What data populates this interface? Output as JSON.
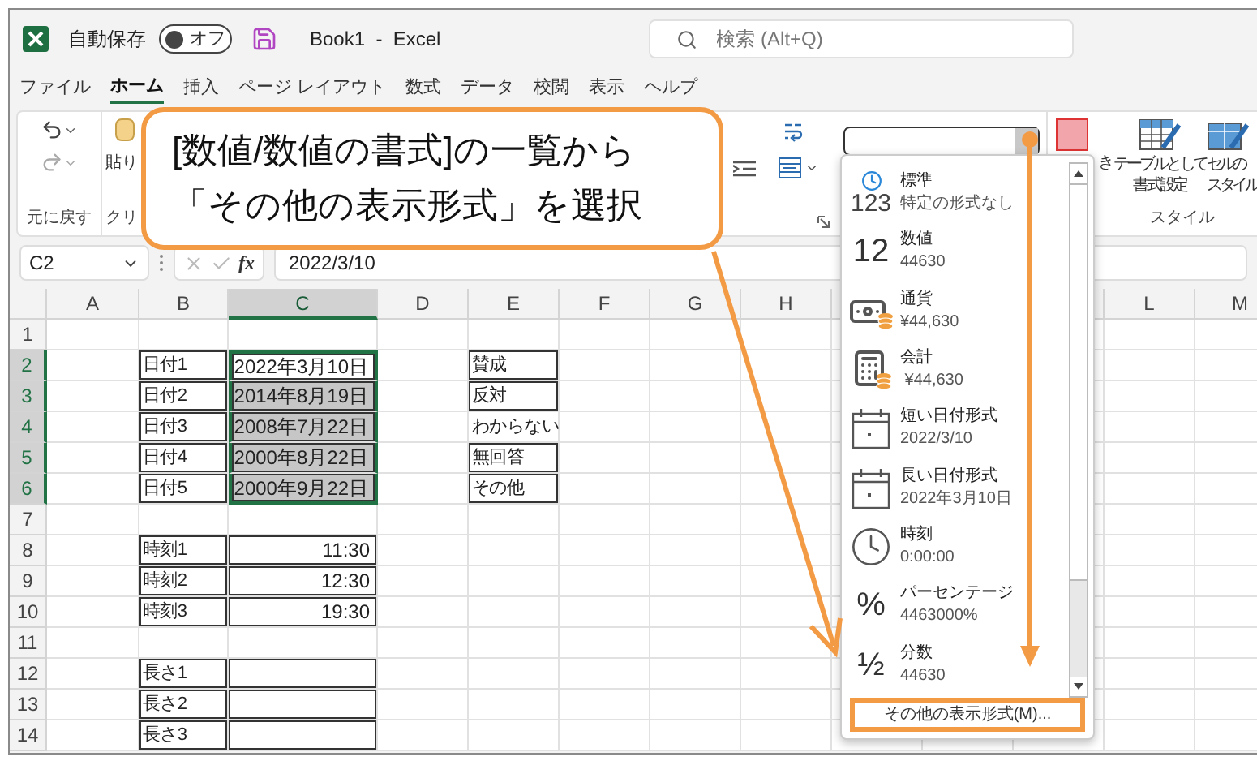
{
  "title_bar": {
    "autosave_label": "自動保存",
    "autosave_toggle": {
      "on": false,
      "label": "オフ"
    },
    "document_title": "Book1  -  Excel",
    "search": {
      "placeholder": "検索 (Alt+Q)"
    }
  },
  "menu_tabs": [
    {
      "label": "ファイル",
      "selected": false
    },
    {
      "label": "ホーム",
      "selected": true
    },
    {
      "label": "挿入",
      "selected": false
    },
    {
      "label": "ページ レイアウト",
      "selected": false
    },
    {
      "label": "数式",
      "selected": false
    },
    {
      "label": "データ",
      "selected": false
    },
    {
      "label": "校閲",
      "selected": false
    },
    {
      "label": "表示",
      "selected": false
    },
    {
      "label": "ヘルプ",
      "selected": false
    }
  ],
  "ribbon": {
    "undo_group_label": "元に戻す",
    "paste_label": "貼り",
    "clipboard_group_label": "クリ",
    "number_format_box": {
      "expanded": true
    },
    "cut_button_label": "き",
    "style_buttons": [
      {
        "kind": "table",
        "lines": [
          "テーブルとして",
          "書式設定"
        ]
      },
      {
        "kind": "cell",
        "lines": [
          "セルの",
          "スタイル"
        ]
      }
    ],
    "style_group_label": "スタイル"
  },
  "formula_bar": {
    "name_box": "C2",
    "function_label": "fx",
    "formula": "2022/3/10"
  },
  "sheet": {
    "columns_left": [
      {
        "label": "A",
        "selected": false
      },
      {
        "label": "B",
        "selected": false
      },
      {
        "label": "C",
        "selected": true
      },
      {
        "label": "D",
        "selected": false
      },
      {
        "label": "E",
        "selected": false
      },
      {
        "label": "F",
        "selected": false
      },
      {
        "label": "G",
        "selected": false
      },
      {
        "label": "H",
        "selected": false
      }
    ],
    "columns_right": [
      {
        "label": "L",
        "selected": false
      },
      {
        "label": "M",
        "selected": false
      }
    ],
    "rows": [
      {
        "number": "1",
        "selected": false
      },
      {
        "number": "2",
        "selected": true,
        "b": {
          "text": "日付1",
          "bordered": true
        },
        "c": {
          "text": "2022年3月10日",
          "bordered": true,
          "selected": true,
          "active": true
        },
        "e": {
          "text": "賛成",
          "bordered": true
        }
      },
      {
        "number": "3",
        "selected": true,
        "b": {
          "text": "日付2",
          "bordered": true
        },
        "c": {
          "text": "2014年8月19日",
          "bordered": true,
          "selected": true,
          "active": false
        },
        "e": {
          "text": "反対",
          "bordered": true
        }
      },
      {
        "number": "4",
        "selected": true,
        "b": {
          "text": "日付3",
          "bordered": true
        },
        "c": {
          "text": "2008年7月22日",
          "bordered": true,
          "selected": true,
          "active": false
        },
        "e": {
          "text": "わからない",
          "bordered": false
        }
      },
      {
        "number": "5",
        "selected": true,
        "b": {
          "text": "日付4",
          "bordered": true
        },
        "c": {
          "text": "2000年8月22日",
          "bordered": true,
          "selected": true,
          "active": false
        },
        "e": {
          "text": "無回答",
          "bordered": true
        }
      },
      {
        "number": "6",
        "selected": true,
        "b": {
          "text": "日付5",
          "bordered": true
        },
        "c": {
          "text": "2000年9月22日",
          "bordered": true,
          "selected": true,
          "active": false
        },
        "e": {
          "text": "その他",
          "bordered": true
        }
      },
      {
        "number": "7",
        "selected": false
      },
      {
        "number": "8",
        "selected": false,
        "b": {
          "text": "時刻1",
          "bordered": true
        },
        "c": {
          "text": "11:30",
          "bordered": true,
          "selected": false,
          "active": false
        }
      },
      {
        "number": "9",
        "selected": false,
        "b": {
          "text": "時刻2",
          "bordered": true
        },
        "c": {
          "text": "12:30",
          "bordered": true,
          "selected": false,
          "active": false
        }
      },
      {
        "number": "10",
        "selected": false,
        "b": {
          "text": "時刻3",
          "bordered": true
        },
        "c": {
          "text": "19:30",
          "bordered": true,
          "selected": false,
          "active": false
        }
      },
      {
        "number": "11",
        "selected": false
      },
      {
        "number": "12",
        "selected": false,
        "b": {
          "text": "長さ1",
          "bordered": true
        },
        "c": {
          "bordered": true,
          "selected": false,
          "active": false
        }
      },
      {
        "number": "13",
        "selected": false,
        "b": {
          "text": "長さ2",
          "bordered": true
        },
        "c": {
          "bordered": true,
          "selected": false,
          "active": false
        }
      },
      {
        "number": "14",
        "selected": false,
        "b": {
          "text": "長さ3",
          "bordered": true
        },
        "c": {
          "bordered": true,
          "selected": false,
          "active": false
        }
      }
    ]
  },
  "format_menu": {
    "items": [
      {
        "kind": "general",
        "glyph": "123",
        "label": "標準",
        "sample": "特定の形式なし"
      },
      {
        "kind": "number",
        "glyph": "12",
        "label": "数値",
        "sample": "44630"
      },
      {
        "kind": "currency",
        "label": "通貨",
        "sample": "¥44,630"
      },
      {
        "kind": "accounting",
        "label": "会計",
        "sample": " ¥44,630"
      },
      {
        "kind": "short_date",
        "label": "短い日付形式",
        "sample": "2022/3/10"
      },
      {
        "kind": "long_date",
        "label": "長い日付形式",
        "sample": "2022年3月10日"
      },
      {
        "kind": "time",
        "label": "時刻",
        "sample": "0:00:00"
      },
      {
        "kind": "percentage",
        "glyph": "%",
        "label": "パーセンテージ",
        "sample": "4463000%"
      },
      {
        "kind": "fraction",
        "glyph": "½",
        "label": "分数",
        "sample": "44630"
      }
    ],
    "more_button": {
      "label": "その他の表示形式(M)...",
      "highlighted": true
    }
  },
  "callout": {
    "lines": [
      "[数値/数値の書式]の一覧から",
      "「その他の表示形式」を選択"
    ]
  }
}
